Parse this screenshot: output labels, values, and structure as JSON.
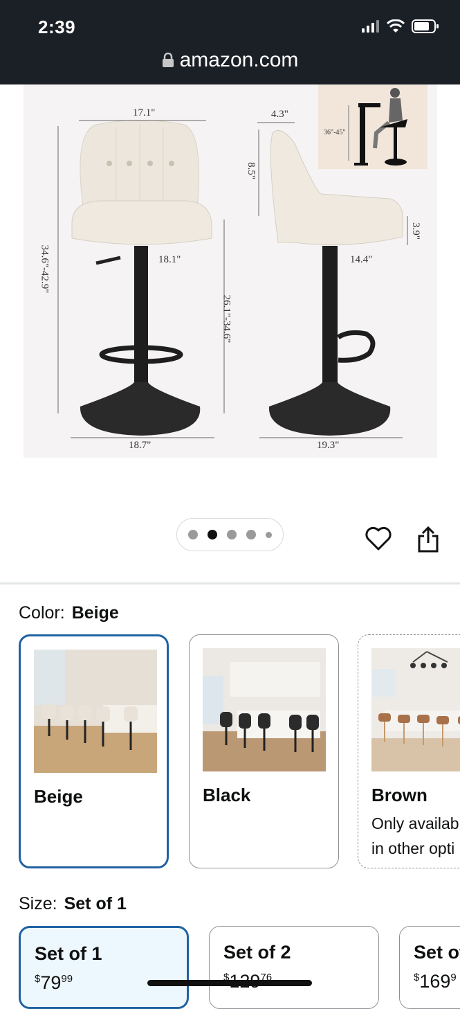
{
  "status": {
    "time": "2:39",
    "url": "amazon.com"
  },
  "product_image": {
    "dimensions": {
      "seat_width": "17.1\"",
      "back_depth_top": "4.3\"",
      "back_height": "8.5\"",
      "total_height": "34.6\"-42.9\"",
      "seat_front": "18.1\"",
      "seat_side": "14.4\"",
      "cushion": "3.9\"",
      "seat_height": "26.1\"-34.6\"",
      "base_front": "18.7\"",
      "base_side": "19.3\"",
      "counter_height": "36\"-45\""
    }
  },
  "carousel": {
    "count": 5,
    "active_index": 1
  },
  "color": {
    "label": "Color:",
    "selected": "Beige",
    "options": [
      {
        "name": "Beige",
        "note": ""
      },
      {
        "name": "Black",
        "note": ""
      },
      {
        "name": "Brown",
        "note": "Only availab\nin other opti"
      }
    ],
    "brown_note_line1": "Only availab",
    "brown_note_line2": "in other opti"
  },
  "size": {
    "label": "Size:",
    "selected": "Set of 1",
    "options": [
      {
        "name": "Set of 1",
        "price_whole": "79",
        "price_fraction": "99"
      },
      {
        "name": "Set of 2",
        "price_whole": "129",
        "price_fraction": "76"
      },
      {
        "name": "Set of",
        "price_whole": "169",
        "price_fraction": "9"
      }
    ]
  },
  "currency": "$",
  "colors": {
    "accent": "#2162a1",
    "status_bar": "#1b1f26"
  }
}
